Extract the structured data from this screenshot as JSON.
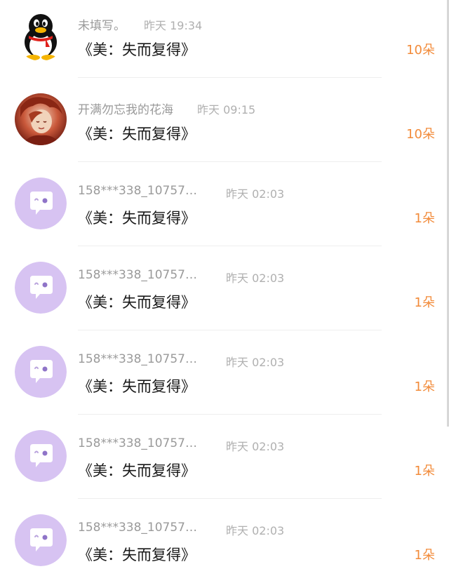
{
  "items": [
    {
      "name": "未填写。",
      "time": "昨天 19:34",
      "title": "《美：失而复得》",
      "count": "10朵",
      "avatar": "qq-penguin-icon"
    },
    {
      "name": "开满勿忘我的花海",
      "time": "昨天 09:15",
      "title": "《美：失而复得》",
      "count": "10朵",
      "avatar": "illustrated-character-avatar"
    },
    {
      "name": "158***338_10757…",
      "time": "昨天 02:03",
      "title": "《美：失而复得》",
      "count": "1朵",
      "avatar": "default-chat-bubble-avatar"
    },
    {
      "name": "158***338_10757…",
      "time": "昨天 02:03",
      "title": "《美：失而复得》",
      "count": "1朵",
      "avatar": "default-chat-bubble-avatar"
    },
    {
      "name": "158***338_10757…",
      "time": "昨天 02:03",
      "title": "《美：失而复得》",
      "count": "1朵",
      "avatar": "default-chat-bubble-avatar"
    },
    {
      "name": "158***338_10757…",
      "time": "昨天 02:03",
      "title": "《美：失而复得》",
      "count": "1朵",
      "avatar": "default-chat-bubble-avatar"
    },
    {
      "name": "158***338_10757…",
      "time": "昨天 02:03",
      "title": "《美：失而复得》",
      "count": "1朵",
      "avatar": "default-chat-bubble-avatar"
    }
  ],
  "colors": {
    "count": "#f28b3a",
    "meta": "#9a9a9a",
    "default_avatar_bg": "#d7c3f2"
  }
}
